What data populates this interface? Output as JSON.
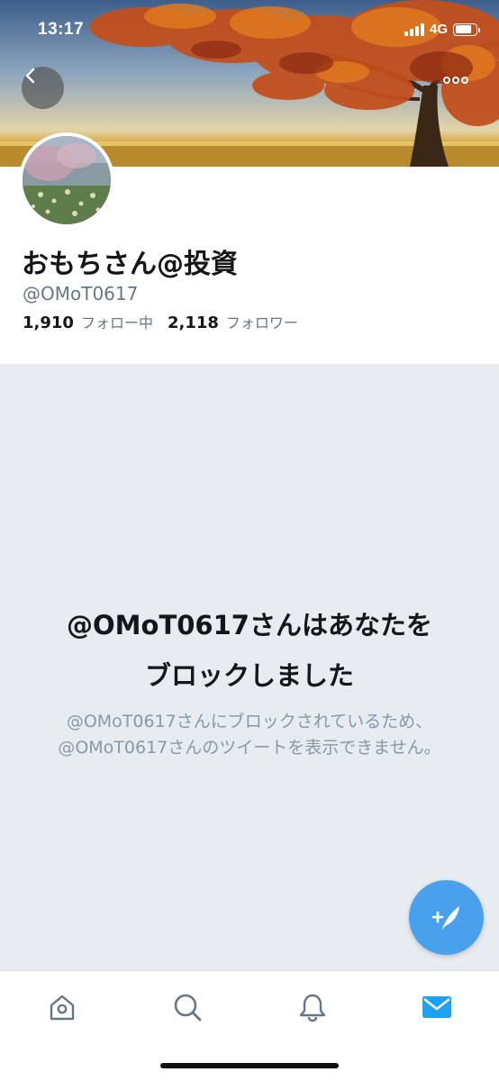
{
  "status_bar": {
    "time": "13:17",
    "network": "4G"
  },
  "header": {
    "back_icon": "chevron-left-icon",
    "more_icon": "more-horizontal-icon"
  },
  "profile": {
    "display_name": "おもちさん@投資",
    "handle": "@OMoT0617",
    "following_count": "1,910",
    "following_label": "フォロー中",
    "followers_count": "2,118",
    "followers_label": "フォロワー"
  },
  "blocked": {
    "title_line1": "@OMoT0617さんはあなたを",
    "title_line2": "ブロックしました",
    "description": "@OMoT0617さんにブロックされているため、@OMoT0617さんのツイートを表示できません。"
  },
  "compose": {
    "icon": "compose-tweet-icon"
  },
  "tabbar": {
    "items": [
      {
        "icon": "home-icon",
        "active": false
      },
      {
        "icon": "search-icon",
        "active": false
      },
      {
        "icon": "bell-icon",
        "active": false
      },
      {
        "icon": "mail-icon",
        "active": true
      }
    ]
  },
  "colors": {
    "accent": "#1da1f2",
    "fab": "#4aa1eb",
    "secondary_text": "#657786",
    "background": "#e6ecf0"
  }
}
